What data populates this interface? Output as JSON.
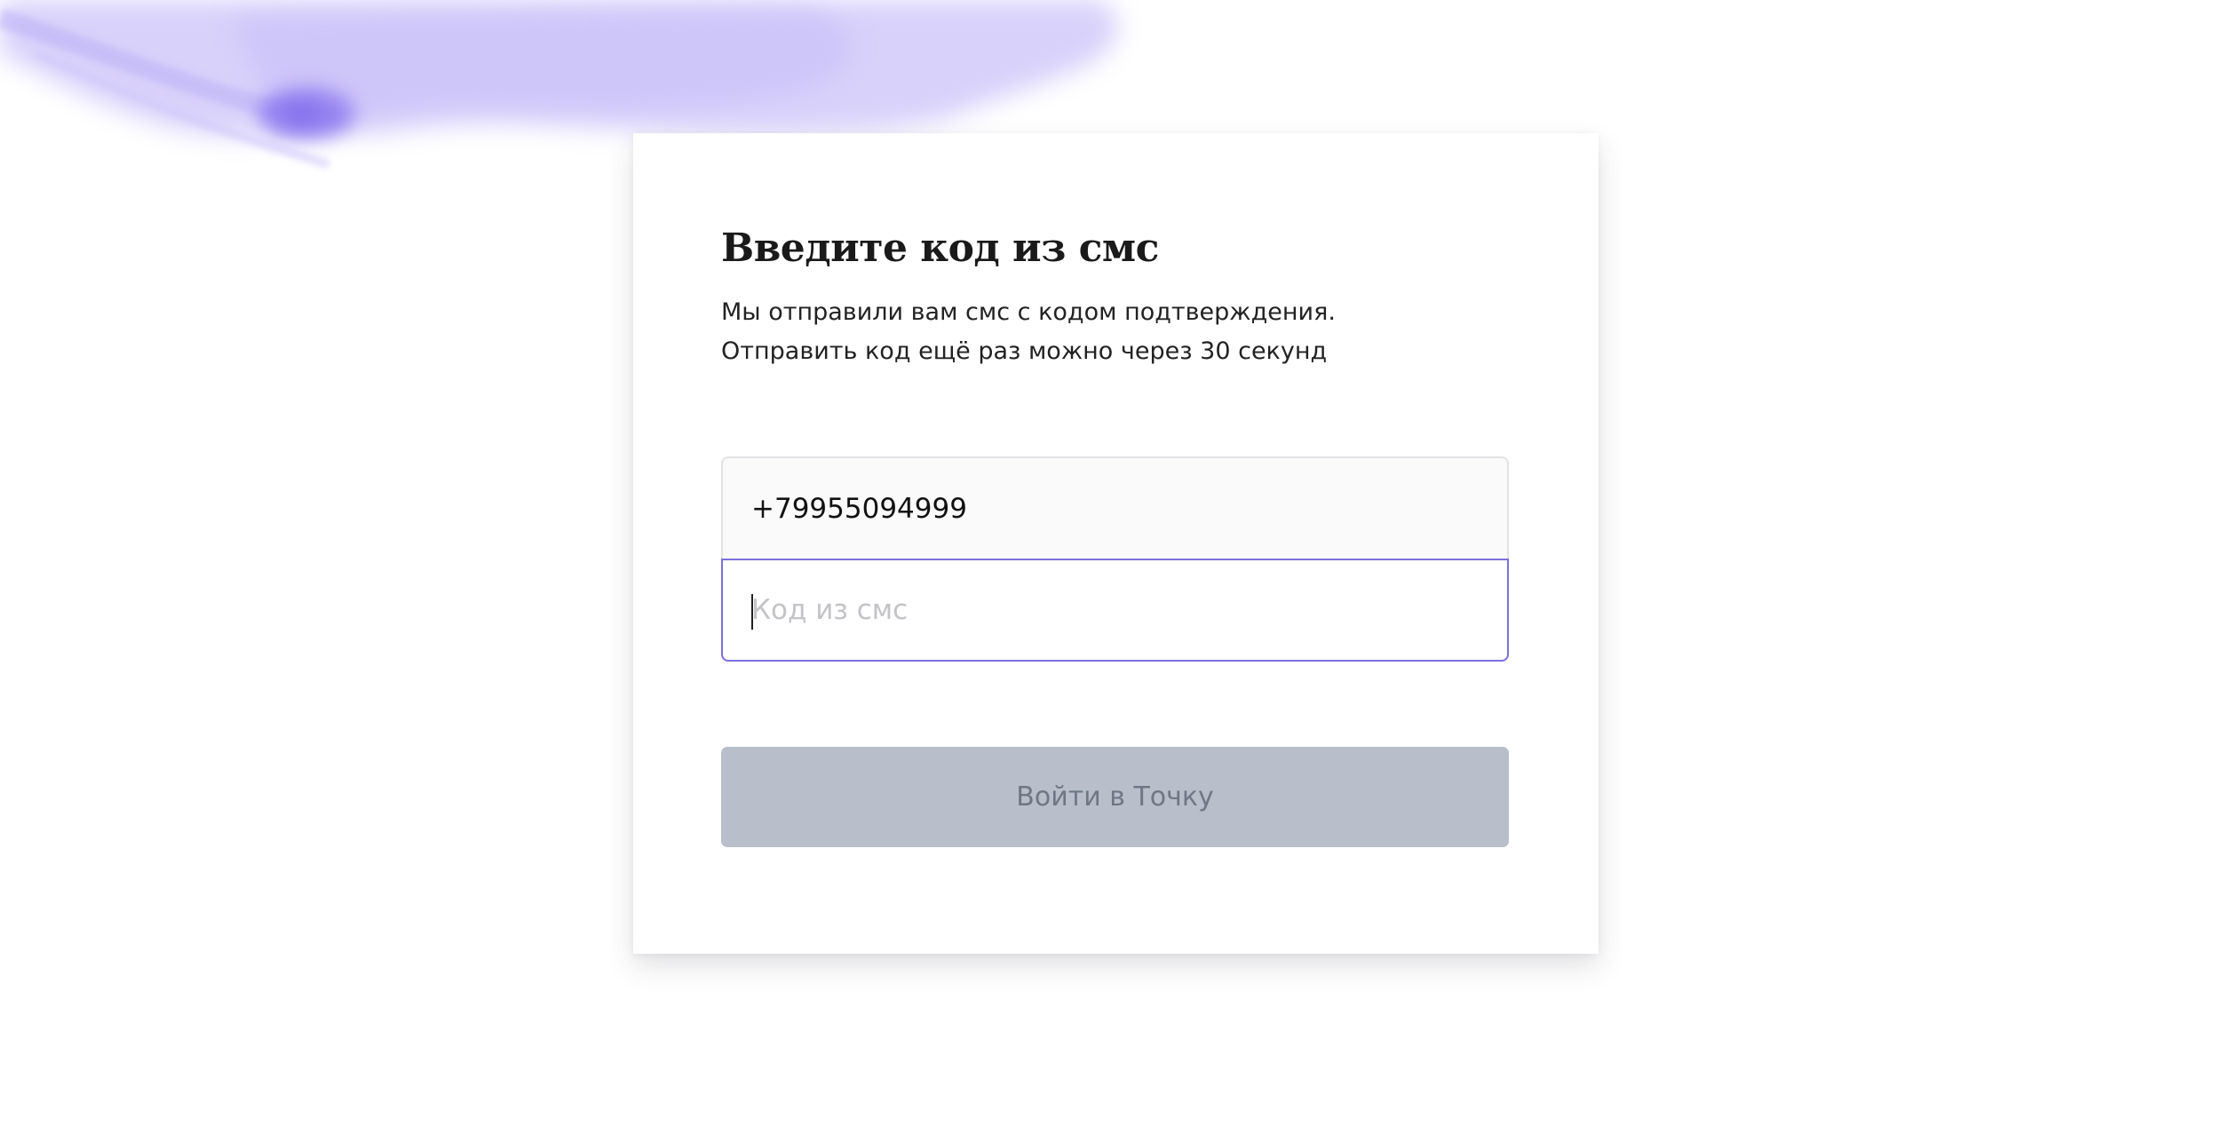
{
  "page": {
    "title": "Введите код из смс",
    "description_line1": "Мы отправили вам смс с кодом подтверждения.",
    "description_line2": "Отправить код ещё раз можно через 30 секунд"
  },
  "form": {
    "phone_value": "+79955094999",
    "code_placeholder": "Код из смс",
    "code_value": "",
    "submit_label": "Войти в Точку"
  },
  "colors": {
    "accent": "#7c6fde",
    "button_disabled_bg": "#b8bfca",
    "button_disabled_text": "#6f7785",
    "watercolor": "#a99af5"
  }
}
